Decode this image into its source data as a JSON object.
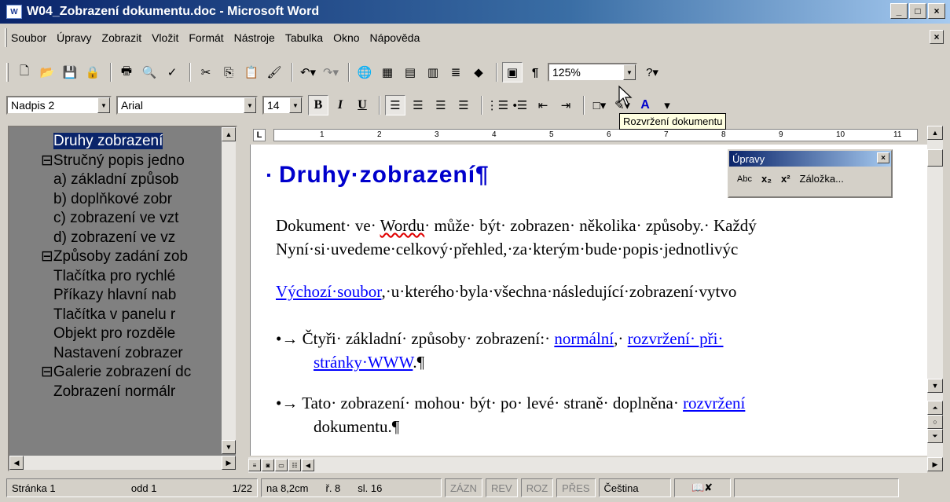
{
  "window": {
    "title": "W04_Zobrazení dokumentu.doc - Microsoft Word",
    "min": "_",
    "max": "□",
    "close": "×"
  },
  "menu": [
    "Soubor",
    "Úpravy",
    "Zobrazit",
    "Vložit",
    "Formát",
    "Nástroje",
    "Tabulka",
    "Okno",
    "Nápověda"
  ],
  "toolbar1": {
    "zoom": "125%"
  },
  "toolbar2": {
    "style": "Nadpis 2",
    "font": "Arial",
    "size": "14",
    "bold": "B",
    "italic": "I",
    "underline": "U",
    "underline_color": "A"
  },
  "tooltip": "Rozvržení dokumentu",
  "docmap": {
    "items": [
      {
        "text": "Druhy zobrazení",
        "indent": 2,
        "selected": true
      },
      {
        "text": "⊟Stručný popis jedno",
        "indent": 1
      },
      {
        "text": "a) základní způsob",
        "indent": 2
      },
      {
        "text": "b) doplňkové zobr",
        "indent": 2
      },
      {
        "text": "c) zobrazení ve vzt",
        "indent": 2
      },
      {
        "text": "d) zobrazení ve vz",
        "indent": 2
      },
      {
        "text": "⊟Způsoby zadání zob",
        "indent": 1
      },
      {
        "text": "Tlačítka pro rychlé",
        "indent": 2
      },
      {
        "text": "Příkazy hlavní nab",
        "indent": 2
      },
      {
        "text": "Tlačítka v panelu r",
        "indent": 2
      },
      {
        "text": "Objekt pro rozděle",
        "indent": 2
      },
      {
        "text": "Nastavení zobrazer",
        "indent": 2
      },
      {
        "text": "⊟Galerie zobrazení dc",
        "indent": 1
      },
      {
        "text": "Zobrazení normálr",
        "indent": 2
      }
    ]
  },
  "ruler": [
    "1",
    "2",
    "3",
    "4",
    "5",
    "6",
    "7",
    "8",
    "9",
    "10",
    "11"
  ],
  "document": {
    "heading": "Druhy·zobrazení¶",
    "p1_line1_a": "Dokument· ve· ",
    "p1_line1_word": "Wordu",
    "p1_line1_b": "· může· být· zobrazen· několika· způsoby.· Každý",
    "p1_line2": "Nyní·si·uvedeme·celkový·přehled,·za·kterým·bude·popis·jednotlivýc",
    "p2_link": "Výchozí·soubor",
    "p2_rest": ",·u·kterého·byla·všechna·následující·zobrazení·vytvo",
    "b1_prefix": "•→ Čtyři· základní· způsoby· zobrazení:· ",
    "b1_link1": "normální",
    "b1_mid": ",· ",
    "b1_link2": "rozvržení· při·",
    "b1_line2_link": "stránky·WWW",
    "b1_line2_rest": ".¶",
    "b2_prefix": "•→ Tato· zobrazení· mohou· být· po· levé· straně· doplněna· ",
    "b2_link": "rozvržení",
    "b2_line2": "dokumentu.¶"
  },
  "floatbar": {
    "title": "Úpravy",
    "abc": "Abc",
    "sub": "x₂",
    "sup": "x²",
    "bookmark": "Záložka..."
  },
  "status": {
    "page": "Stránka 1",
    "section": "odd 1",
    "pages": "1/22",
    "at": "na 8,2cm",
    "line": "ř. 8",
    "col": "sl. 16",
    "rec": "ZÁZN",
    "trk": "REV",
    "ext": "ROZ",
    "ovr": "PŘES",
    "lang": "Čeština"
  }
}
